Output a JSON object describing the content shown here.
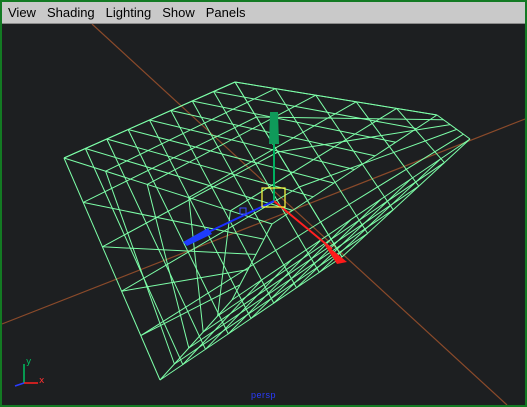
{
  "menu": {
    "items": [
      "View",
      "Shading",
      "Lighting",
      "Show",
      "Panels"
    ]
  },
  "viewport": {
    "camera_label": "persp",
    "axis_labels": {
      "x": "x",
      "y": "y"
    },
    "colors": {
      "background": "#1d1f21",
      "grid_line": "#8a4a2a",
      "wireframe": "#7dffa8",
      "manip_x": "#ff2020",
      "manip_y": "#00b060",
      "manip_z": "#1a2cff",
      "pivot_box": "#ffff40"
    }
  }
}
